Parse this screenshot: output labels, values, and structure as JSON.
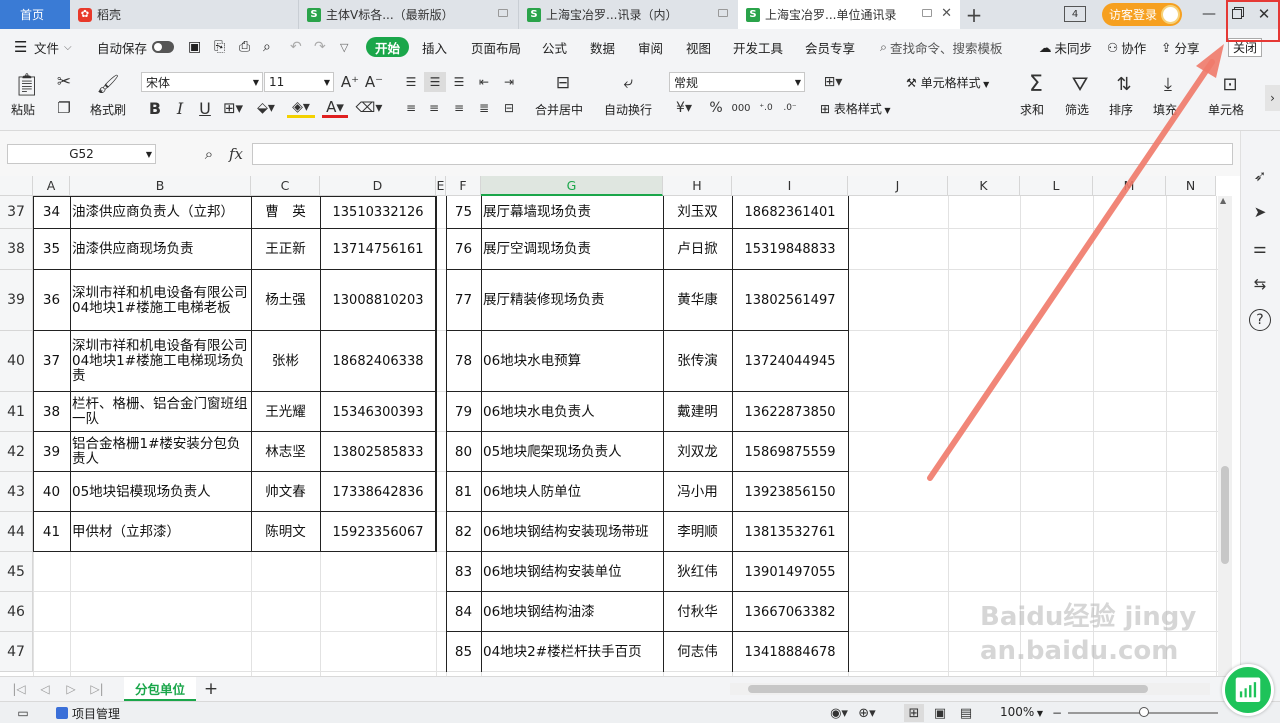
{
  "tabs": [
    {
      "label": "首页"
    },
    {
      "label": "稻壳"
    },
    {
      "label": "主体V标各...（最新版）"
    },
    {
      "label": "上海宝冶罗...讯录（内）"
    },
    {
      "label": "上海宝冶罗...单位通讯录"
    }
  ],
  "titlebar": {
    "badge": "4",
    "login": "访客登录"
  },
  "menu": {
    "file": "文件",
    "autosave": "自动保存",
    "items": [
      "开始",
      "插入",
      "页面布局",
      "公式",
      "数据",
      "审阅",
      "视图",
      "开发工具",
      "会员专享"
    ],
    "search": "查找命令、搜索模板",
    "sync": "未同步",
    "collab": "协作",
    "share": "分享",
    "close": "关闭"
  },
  "ribbon": {
    "paste": "粘贴",
    "format_painter": "格式刷",
    "font_name": "宋体",
    "font_size": "11",
    "merge": "合并居中",
    "wrap": "自动换行",
    "number_format": "常规",
    "cell_style": "单元格样式",
    "table_style": "表格样式",
    "sum": "求和",
    "filter": "筛选",
    "sort": "排序",
    "fill": "填充",
    "cells": "单元格"
  },
  "formula": {
    "cellref": "G52",
    "fx": "fx",
    "value": ""
  },
  "columns": [
    "A",
    "B",
    "C",
    "D",
    "E",
    "F",
    "G",
    "H",
    "I",
    "J",
    "K",
    "L",
    "M",
    "N"
  ],
  "rows": [
    {
      "num": "37",
      "a": "34",
      "b": "油漆供应商负责人（立邦）",
      "c": "曹　英",
      "d": "13510332126",
      "f": "75",
      "g": "展厅幕墙现场负责",
      "h": "刘玉双",
      "i": "18682361401"
    },
    {
      "num": "38",
      "a": "35",
      "b": "油漆供应商现场负责",
      "c": "王正新",
      "d": "13714756161",
      "f": "76",
      "g": "展厅空调现场负责",
      "h": "卢日掀",
      "i": "15319848833"
    },
    {
      "num": "39",
      "a": "36",
      "b": "深圳市祥和机电设备有限公司04地块1#楼施工电梯老板",
      "c": "杨土强",
      "d": "13008810203",
      "f": "77",
      "g": "展厅精装修现场负责",
      "h": "黄华康",
      "i": "13802561497"
    },
    {
      "num": "40",
      "a": "37",
      "b": "深圳市祥和机电设备有限公司04地块1#楼施工电梯现场负责",
      "c": "张彬",
      "d": "18682406338",
      "f": "78",
      "g": "06地块水电预算",
      "h": "张传演",
      "i": "13724044945"
    },
    {
      "num": "41",
      "a": "38",
      "b": "栏杆、格栅、铝合金门窗班组一队",
      "c": "王光耀",
      "d": "15346300393",
      "f": "79",
      "g": "06地块水电负责人",
      "h": "戴建明",
      "i": "13622873850"
    },
    {
      "num": "42",
      "a": "39",
      "b": "铝合金格栅1#楼安装分包负责人",
      "c": "林志坚",
      "d": "13802585833",
      "f": "80",
      "g": "05地块爬架现场负责人",
      "h": "刘双龙",
      "i": "15869875559"
    },
    {
      "num": "43",
      "a": "40",
      "b": "05地块铝模现场负责人",
      "c": "帅文春",
      "d": "17338642836",
      "f": "81",
      "g": "06地块人防单位",
      "h": "冯小用",
      "i": "13923856150"
    },
    {
      "num": "44",
      "a": "41",
      "b": "甲供材（立邦漆）",
      "c": "陈明文",
      "d": "15923356067",
      "f": "82",
      "g": "06地块钢结构安装现场带班",
      "h": "李明顺",
      "i": "13813532761"
    },
    {
      "num": "45",
      "a": "",
      "b": "",
      "c": "",
      "d": "",
      "f": "83",
      "g": "06地块钢结构安装单位",
      "h": "狄红伟",
      "i": "13901497055"
    },
    {
      "num": "46",
      "a": "",
      "b": "",
      "c": "",
      "d": "",
      "f": "84",
      "g": "06地块钢结构油漆",
      "h": "付秋华",
      "i": "13667063382"
    },
    {
      "num": "47",
      "a": "",
      "b": "",
      "c": "",
      "d": "",
      "f": "85",
      "g": "04地块2#楼栏杆扶手百页",
      "h": "何志伟",
      "i": "13418884678"
    }
  ],
  "sheet": {
    "name": "分包单位"
  },
  "status": {
    "project": "项目管理",
    "zoom": "100%"
  },
  "watermark": "Baidu经验 jingyan.baidu.com",
  "colors": {
    "accent_green": "#1aa64a",
    "highlight_red": "#e53935",
    "arrow": "#f07a6a"
  }
}
